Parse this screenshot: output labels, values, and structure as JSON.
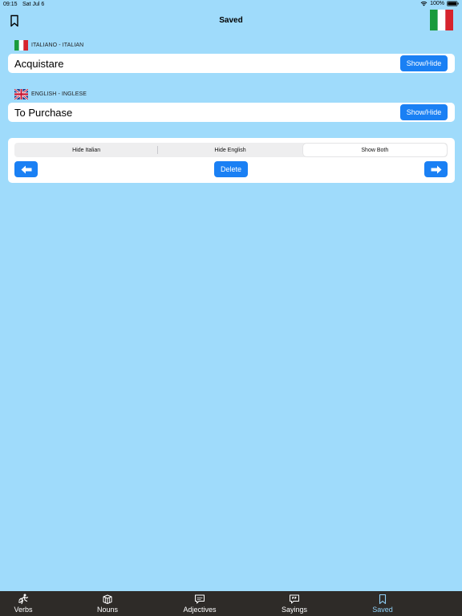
{
  "status": {
    "time": "09:15",
    "date": "Sat Jul 6",
    "battery": "100%"
  },
  "nav": {
    "title": "Saved"
  },
  "italian": {
    "label": "ITALIANO - ITALIAN",
    "word": "Acquistare",
    "toggle_label": "Show/Hide"
  },
  "english": {
    "label": "ENGLISH - INGLESE",
    "word": "To Purchase",
    "toggle_label": "Show/Hide"
  },
  "controls": {
    "segments": [
      "Hide Italian",
      "Hide English",
      "Show Both"
    ],
    "selected_segment": "Show Both",
    "delete_label": "Delete"
  },
  "tabs": [
    {
      "label": "Verbs",
      "icon": "running-person-icon"
    },
    {
      "label": "Nouns",
      "icon": "cubes-icon"
    },
    {
      "label": "Adjectives",
      "icon": "speech-bubble-icon"
    },
    {
      "label": "Sayings",
      "icon": "quote-bubble-icon"
    },
    {
      "label": "Saved",
      "icon": "bookmark-icon",
      "active": true
    }
  ],
  "colors": {
    "background": "#9fdbfb",
    "accent": "#1a80f4",
    "tab_bar": "#2e2b28",
    "tab_active": "#8fd0f7"
  }
}
